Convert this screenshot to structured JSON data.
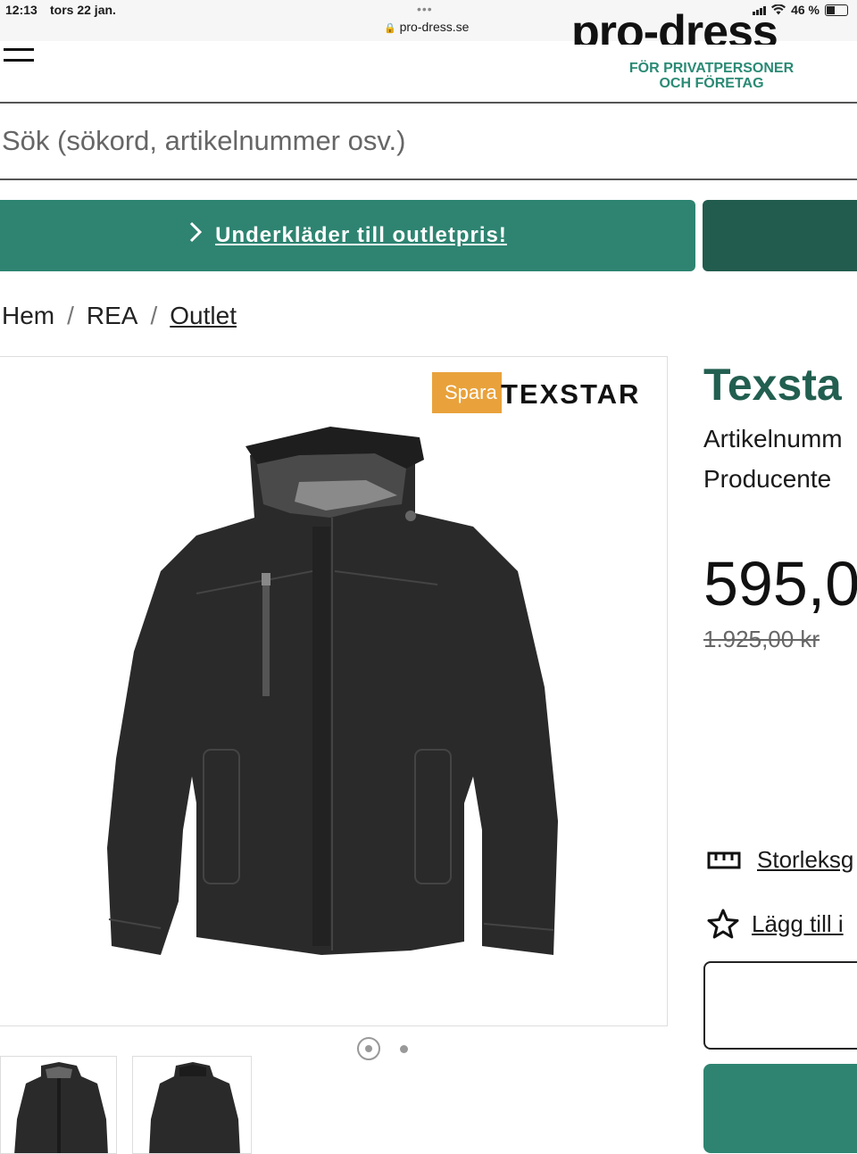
{
  "status_bar": {
    "time": "12:13",
    "date": "tors 22 jan.",
    "url": "pro-dress.se",
    "battery": "46 %"
  },
  "header": {
    "logo_text": "pro-dress",
    "logo_sub_line1": "FÖR PRIVATPERSONER",
    "logo_sub_line2": "OCH FÖRETAG",
    "menu_icon": "hamburger-icon"
  },
  "search": {
    "placeholder": "Sök (sökord, artikelnummer osv.)"
  },
  "banner": {
    "label": "Underkläder till outletpris!",
    "icon": "chevron-right-icon"
  },
  "breadcrumb": {
    "items": [
      "Hem",
      "REA",
      "Outlet"
    ],
    "separator": "/"
  },
  "product": {
    "badge": "Spara",
    "brand_logo": "TEXSTAR",
    "title": "Texsta",
    "article_label": "Artikelnumm",
    "producer_label": "Producente",
    "price": "595,0",
    "old_price": "1.925,00 kr",
    "size_guide": "Storleksg",
    "wishlist": "Lägg till i"
  },
  "colors": {
    "brand_green": "#2e8471",
    "dark_green": "#225f50",
    "badge_orange": "#e9a23b"
  }
}
